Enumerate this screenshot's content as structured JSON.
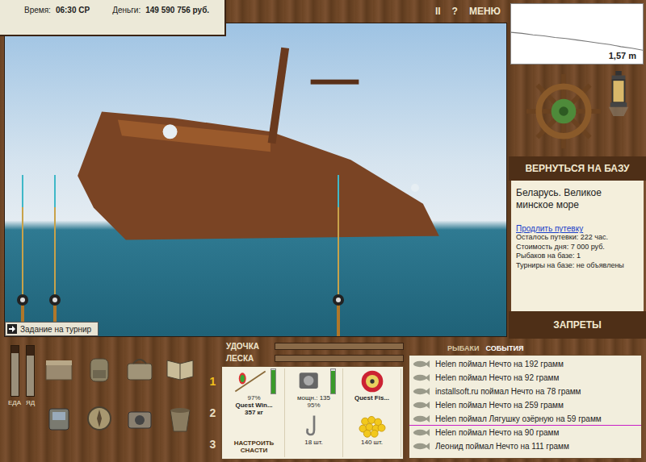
{
  "status": {
    "time_label": "Время:",
    "time": "06:30 СР",
    "money_label": "Деньги:",
    "money": "149 590 756 руб."
  },
  "toolbar": [
    "II",
    "?",
    "МЕНЮ"
  ],
  "depth": {
    "reading": "1,57 m",
    "profile": [
      1.22,
      1.24,
      1.27,
      1.29,
      1.32,
      1.34,
      1.37,
      1.4,
      1.43,
      1.46,
      1.5,
      1.53,
      1.57
    ]
  },
  "return_button": "ВЕРНУТЬСЯ НА БАЗУ",
  "location": {
    "title": "Беларусь. Великое минское море",
    "link": "Продлить путевку",
    "lines": [
      "Осталось путевки: 222 час.",
      "Стоимость дня: 7 000 руб.",
      "Рыбаков на базе: 1",
      "Турниры на базе: не объявлены"
    ]
  },
  "bans_button": "ЗАПРЕТЫ",
  "tournament_task": "Задание на турнир",
  "meters": [
    {
      "label": "ЕДА",
      "level": 0.85
    },
    {
      "label": "ЯД",
      "level": 0.8
    }
  ],
  "tension": [
    {
      "label": "УДОЧКА",
      "level": 0
    },
    {
      "label": "ЛЕСКА",
      "level": 0
    }
  ],
  "log_tabs": [
    {
      "label": "РЫБАКИ",
      "selected": false
    },
    {
      "label": "СОБЫТИЯ",
      "selected": true
    }
  ],
  "rod_slots": [
    {
      "label": "1",
      "selected": true
    },
    {
      "label": "2",
      "selected": false
    },
    {
      "label": "3",
      "selected": false
    }
  ],
  "tackle": {
    "rod": {
      "name": "Quest Win...",
      "weight": "357 кг",
      "wear": "97%",
      "level": 0.97
    },
    "reel": {
      "power": "мощн.: 135",
      "wear": "95%",
      "level": 0.95
    },
    "line": {
      "name": "Quest Fis..."
    },
    "hooks": {
      "count": "18 шт."
    },
    "bait": {
      "count": "140 шт."
    },
    "setup_button": "НАСТРОИТЬ СНАСТИ"
  },
  "events": [
    {
      "text": "Helen поймал Нечто на 192 грамм",
      "highlighted": false
    },
    {
      "text": "Helen поймал Нечто на 92 грамм",
      "highlighted": false
    },
    {
      "text": "installsoft.ru поймал Нечто на 78 грамм",
      "highlighted": false
    },
    {
      "text": "Helen поймал Нечто на 259 грамм",
      "highlighted": false
    },
    {
      "text": "Helen поймал Лягушку озёрную на 59 грамм",
      "highlighted": true
    },
    {
      "text": "Helen поймал Нечто на 90 грамм",
      "highlighted": false
    },
    {
      "text": "Леонид поймал Нечто на 111 грамм",
      "highlighted": false
    }
  ]
}
